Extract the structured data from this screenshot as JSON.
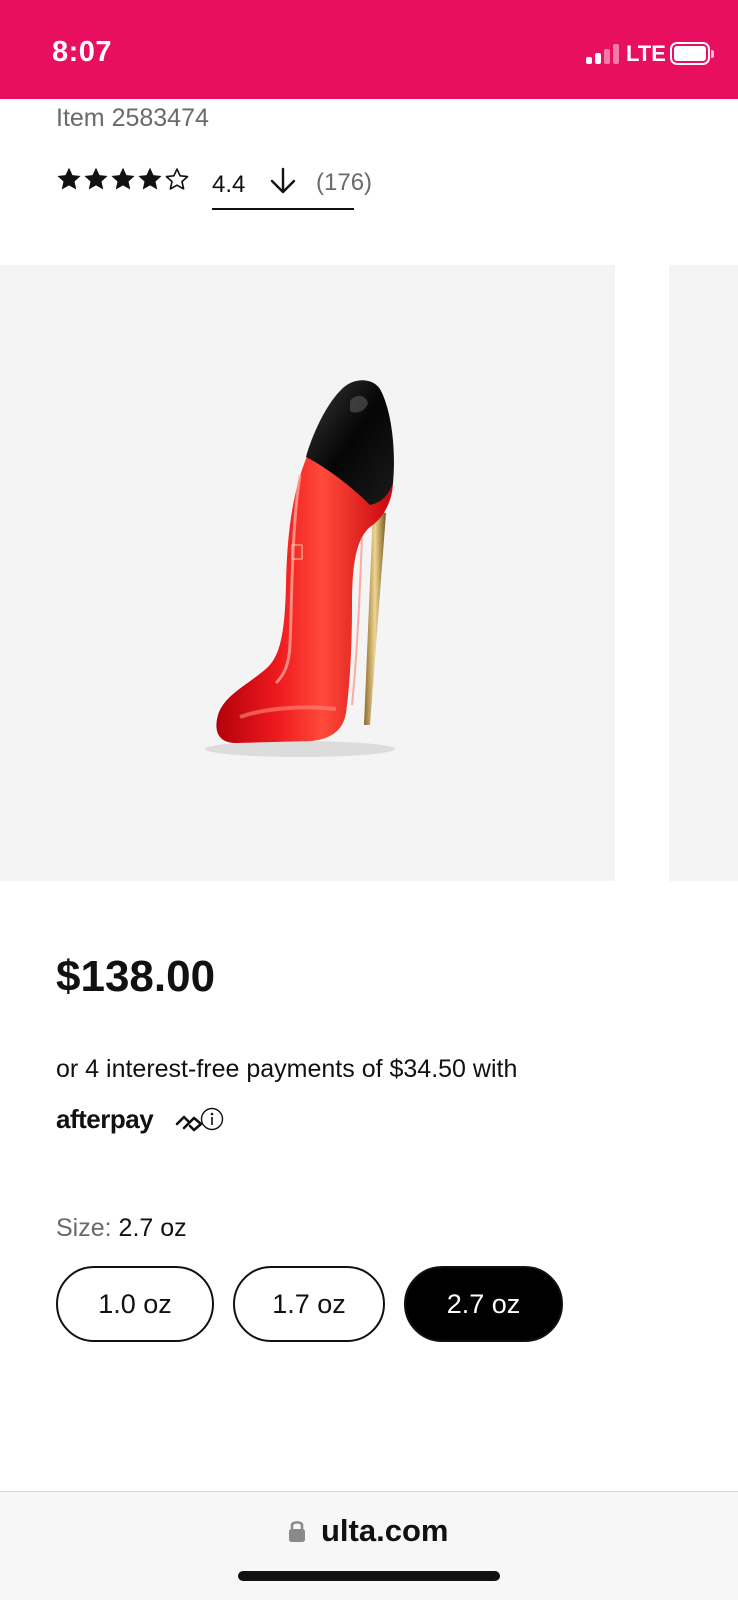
{
  "status_bar": {
    "time": "8:07",
    "network": "LTE",
    "background_color": "#e90f60",
    "signal_icon": "cellular-signal-icon",
    "battery_icon": "battery-icon"
  },
  "product": {
    "item_number": "Item 2583474",
    "rating": {
      "stars_filled": 4,
      "stars_total": 5,
      "value": "4.4",
      "review_count": "(176)",
      "sort_icon": "arrow-down-icon"
    },
    "image": {
      "description_icon": "red-stiletto-perfume-bottle",
      "has_next_slide": true
    },
    "price": "$138.00",
    "installments_text": "or 4 interest-free payments of $34.50 with",
    "afterpay": {
      "logo_text": "afterpay",
      "info_icon": "info-circle-icon"
    },
    "size": {
      "label": "Size:",
      "selected_value": "2.7 oz",
      "options": [
        {
          "label": "1.0 oz",
          "selected": false
        },
        {
          "label": "1.7 oz",
          "selected": false
        },
        {
          "label": "2.7 oz",
          "selected": true
        }
      ]
    }
  },
  "browser": {
    "url": "ulta.com",
    "lock_icon": "lock-icon"
  },
  "colors": {
    "brand_pink": "#e90f60",
    "selected_option": "#000000",
    "gallery_background": "#f4f4f4",
    "secondary_text": "#6a6a6a"
  }
}
